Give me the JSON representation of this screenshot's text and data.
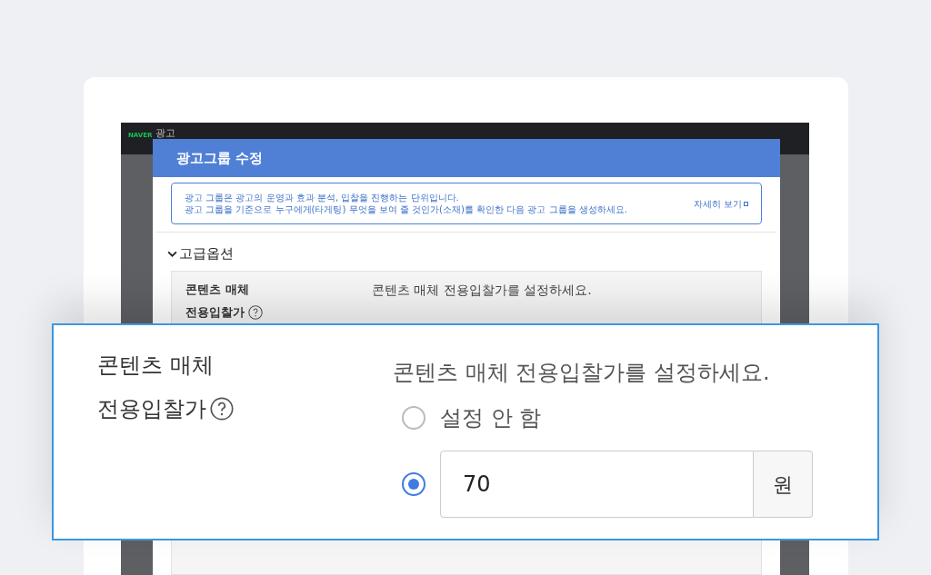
{
  "app": {
    "logo": "NAVER",
    "brand": "광고"
  },
  "modal": {
    "title": "광고그룹 수정",
    "info": {
      "lines": [
        "광고 그룹은 광고의 운영과 효과 분석, 입찰을 진행하는 단위입니다.",
        "광고 그룹을 기준으로 누구에게(타게팅) 무엇을 보여 줄 것인가(소재)를 확인한 다음 광고 그룹을 생성하세요."
      ],
      "link": "자세히 보기"
    },
    "section": {
      "title": "고급옵션",
      "expanded": true
    },
    "panel": {
      "label_lines": [
        "콘텐츠 매체",
        "전용입찰가"
      ],
      "prompt": "콘텐츠 매체 전용입찰가를 설정하세요."
    }
  },
  "callout": {
    "label_lines": [
      "콘텐츠 매체",
      "전용입찰가"
    ],
    "prompt": "콘텐츠 매체 전용입찰가를 설정하세요.",
    "options": [
      {
        "kind": "none",
        "label": "설정 안 함",
        "selected": false
      },
      {
        "kind": "amount",
        "value": "70",
        "unit": "원",
        "selected": true
      }
    ]
  }
}
